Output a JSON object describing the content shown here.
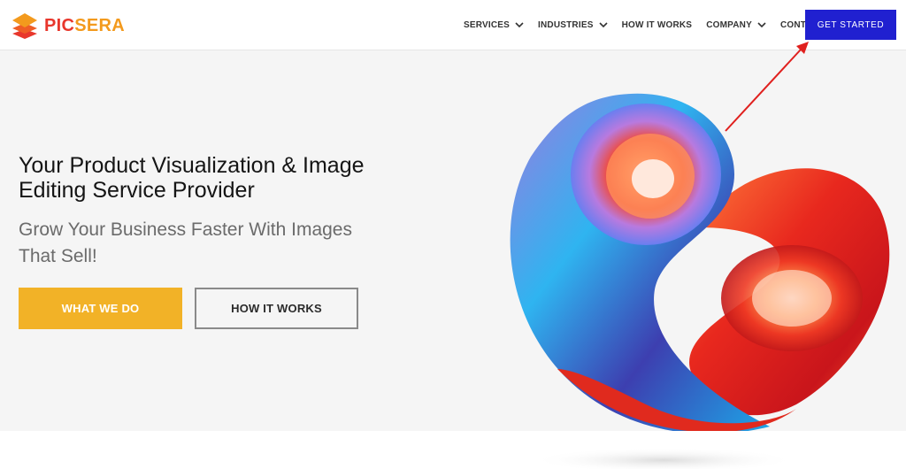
{
  "brand": {
    "name_part1": "PIC",
    "name_part2": "SERA",
    "colors": {
      "pic": "#e8372c",
      "sera": "#f39a1d"
    },
    "icon": "stacked-layers-logo-icon"
  },
  "nav": {
    "items": [
      {
        "label": "SERVICES",
        "has_dropdown": true
      },
      {
        "label": "INDUSTRIES",
        "has_dropdown": true
      },
      {
        "label": "HOW IT WORKS",
        "has_dropdown": false
      },
      {
        "label": "COMPANY",
        "has_dropdown": true
      },
      {
        "label": "CONTACT",
        "has_dropdown": false
      }
    ],
    "cta_label": "GET STARTED",
    "cta_color": "#2020d0"
  },
  "hero": {
    "headline": "Your Product Visualization & Image Editing Service Provider",
    "subhead": "Grow Your Business Faster With Images That Sell!",
    "primary_button": "WHAT WE DO",
    "secondary_button": "HOW IT WORKS",
    "primary_color": "#f2b227",
    "background": "#f5f5f5"
  },
  "annotation": {
    "type": "red-arrow",
    "target": "get-started-button",
    "color": "#e0201e"
  }
}
